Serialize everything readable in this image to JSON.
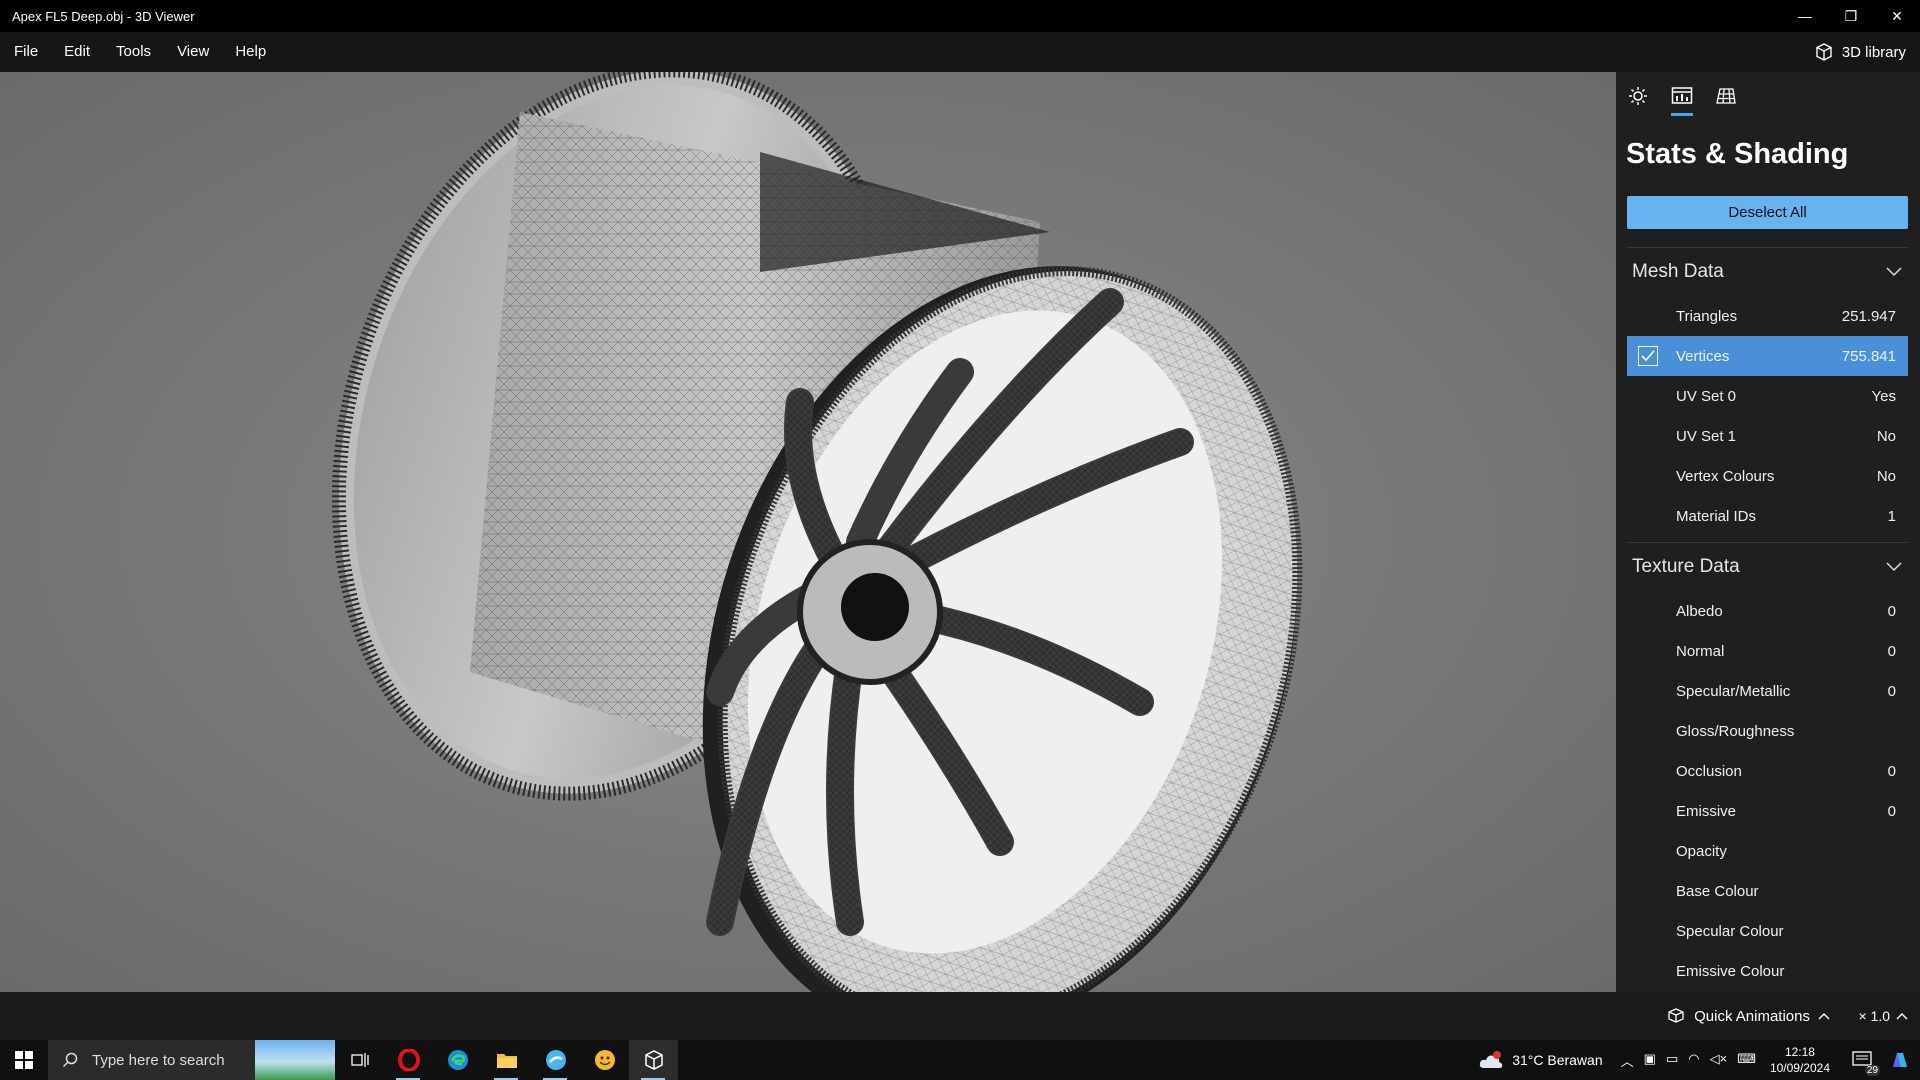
{
  "window": {
    "title": "Apex FL5 Deep.obj - 3D Viewer",
    "minimize": "—",
    "restore": "❐",
    "close": "✕"
  },
  "menu": {
    "items": [
      "File",
      "Edit",
      "Tools",
      "View",
      "Help"
    ],
    "library_label": "3D library"
  },
  "panel": {
    "tabs": [
      "lighting-tab",
      "stats-tab",
      "grid-tab"
    ],
    "active_tab": "stats-tab",
    "title": "Stats & Shading",
    "deselect_label": "Deselect All",
    "mesh_section": {
      "label": "Mesh Data",
      "rows": [
        {
          "label": "Triangles",
          "value": "251.947",
          "selected": false
        },
        {
          "label": "Vertices",
          "value": "755.841",
          "selected": true
        },
        {
          "label": "UV Set 0",
          "value": "Yes",
          "selected": false
        },
        {
          "label": "UV Set 1",
          "value": "No",
          "selected": false
        },
        {
          "label": "Vertex Colours",
          "value": "No",
          "selected": false
        },
        {
          "label": "Material IDs",
          "value": "1",
          "selected": false
        }
      ]
    },
    "texture_section": {
      "label": "Texture Data",
      "rows": [
        {
          "label": "Albedo",
          "value": "0"
        },
        {
          "label": "Normal",
          "value": "0"
        },
        {
          "label": "Specular/Metallic",
          "value": "0"
        },
        {
          "label": "Gloss/Roughness",
          "value": ""
        },
        {
          "label": "Occlusion",
          "value": "0"
        },
        {
          "label": "Emissive",
          "value": "0"
        },
        {
          "label": "Opacity",
          "value": ""
        },
        {
          "label": "Base Colour",
          "value": ""
        },
        {
          "label": "Specular Colour",
          "value": ""
        },
        {
          "label": "Emissive Colour",
          "value": ""
        }
      ]
    }
  },
  "statusbar": {
    "quick_animations": "Quick Animations",
    "speed": "× 1.0"
  },
  "taskbar": {
    "search_placeholder": "Type here to search",
    "weather": "31°C  Berawan",
    "weather_alert": "1",
    "time": "12:18",
    "date": "10/09/2024",
    "notifications": "29"
  },
  "colors": {
    "accent": "#66b3f0",
    "selected_row": "#4a90d9",
    "panel_bg": "#1f1f1f"
  }
}
